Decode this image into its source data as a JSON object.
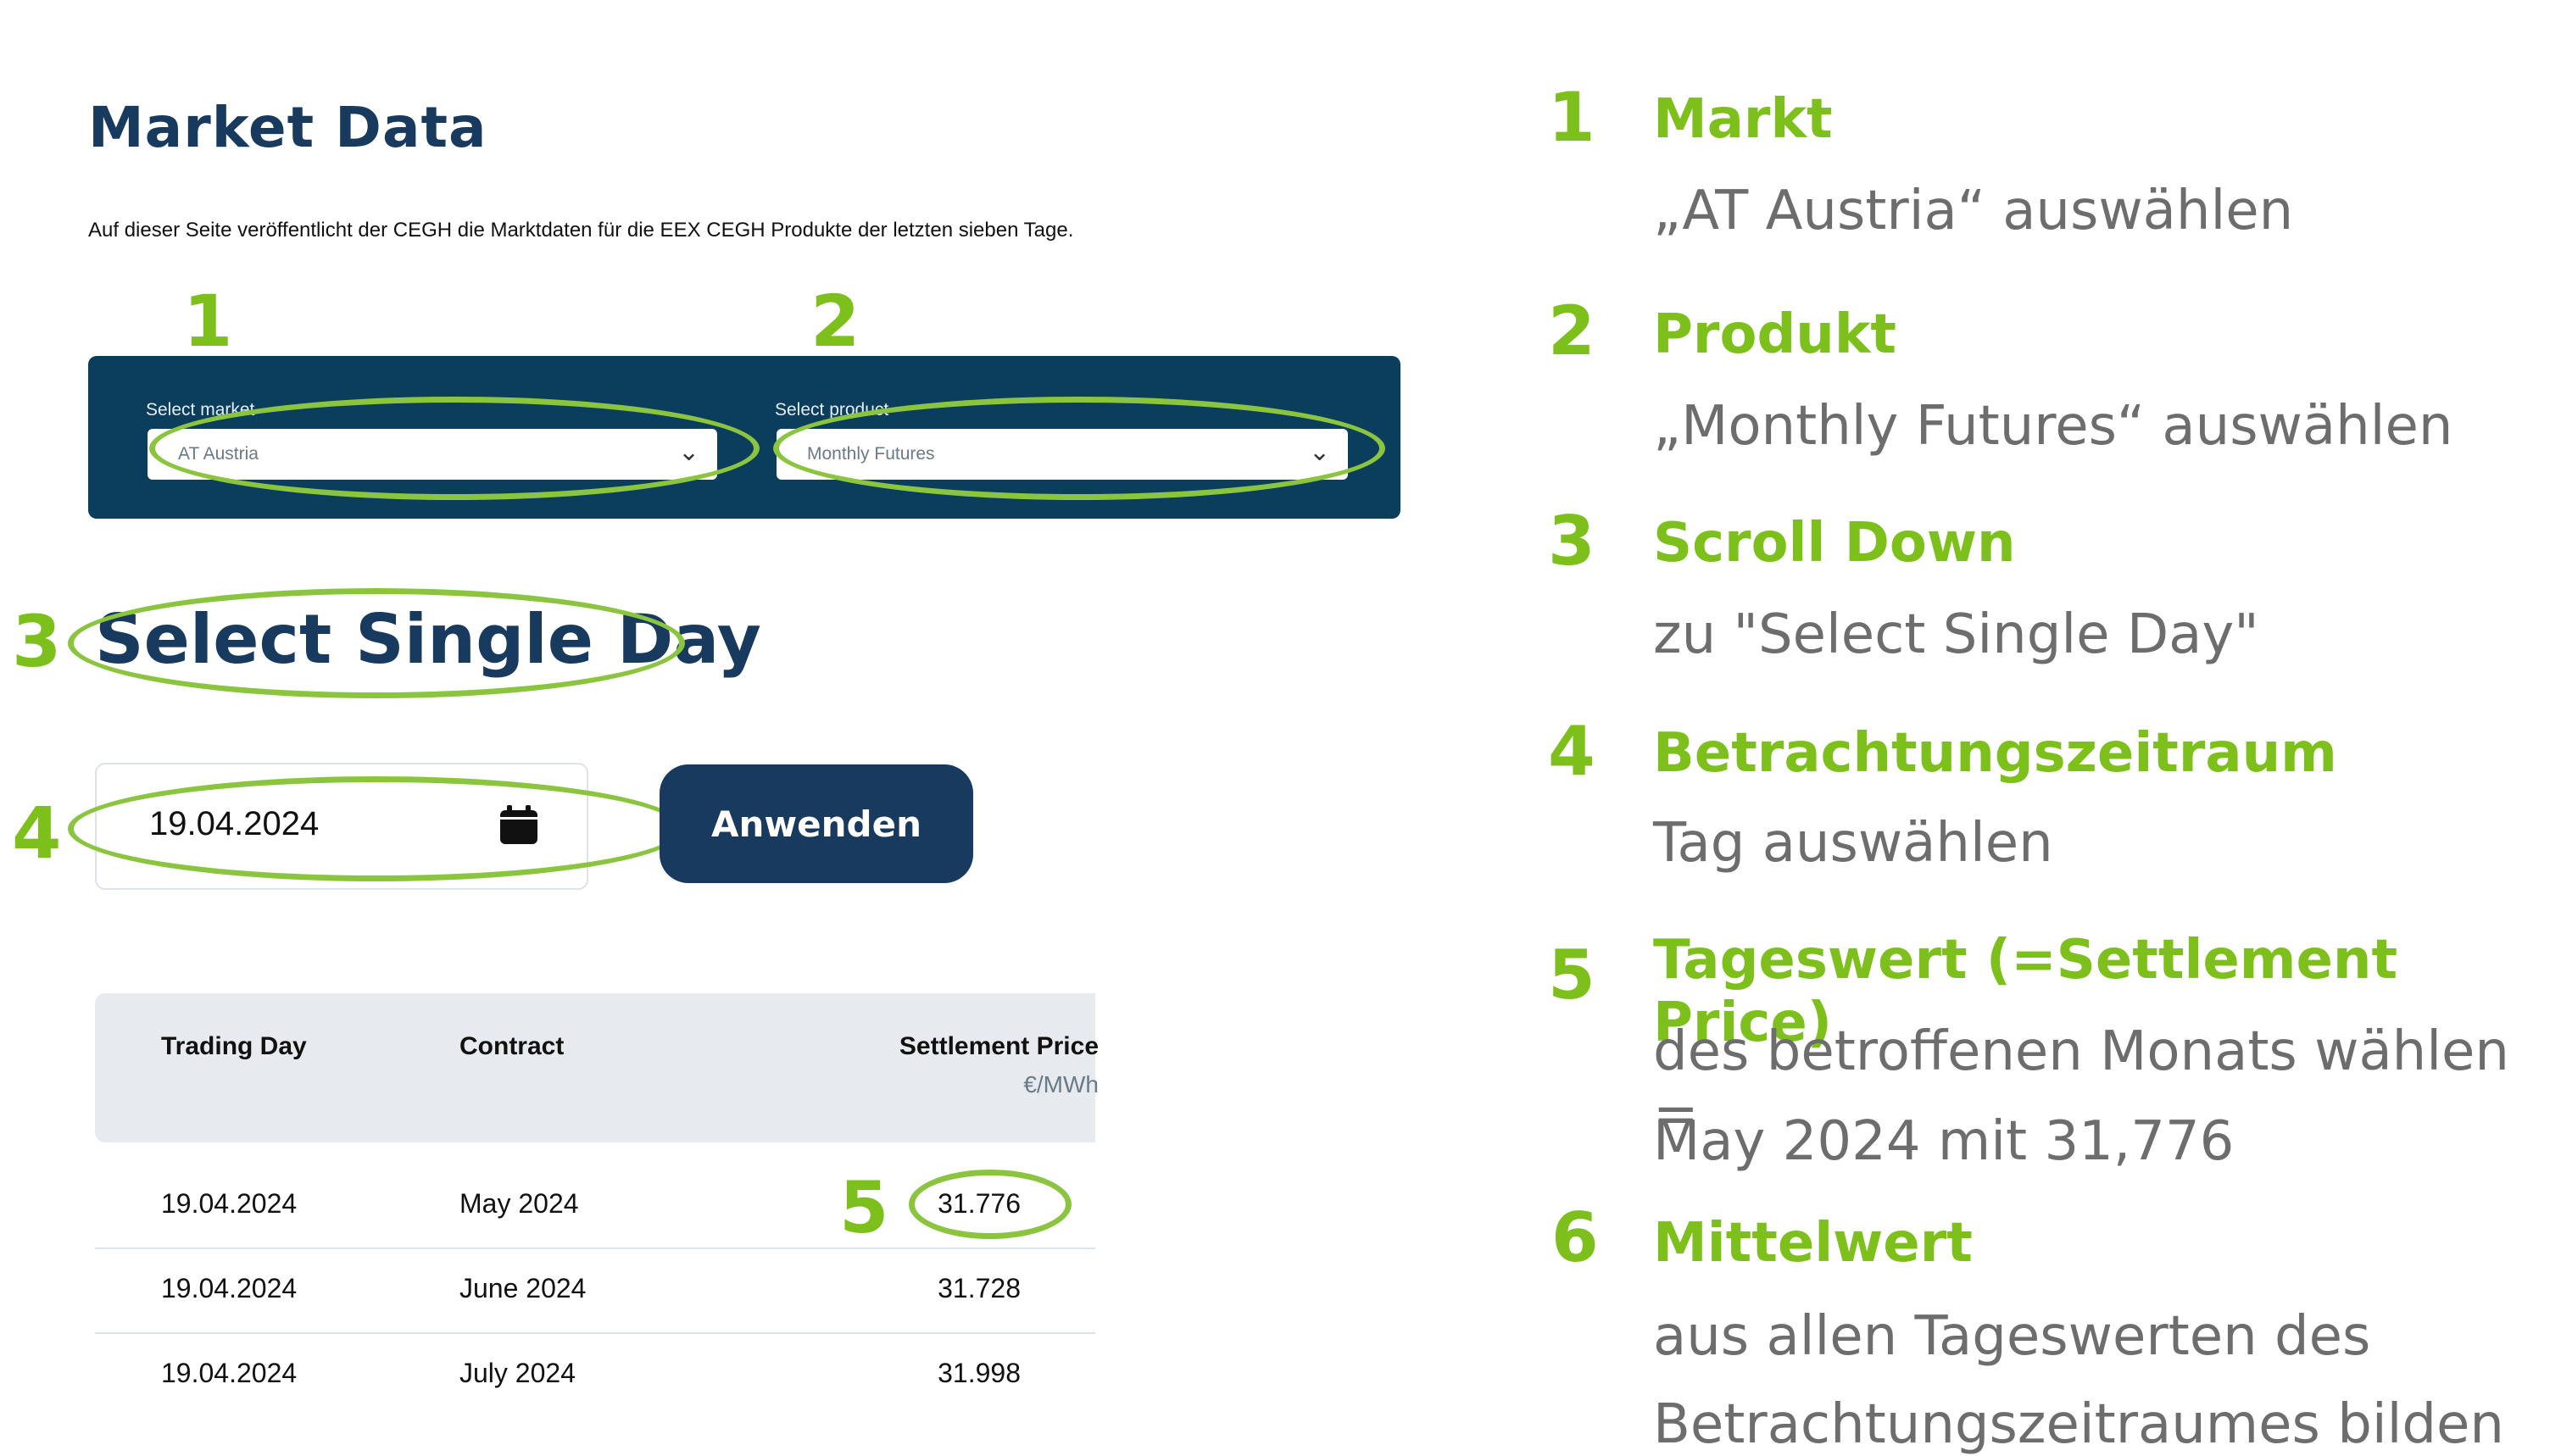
{
  "screenshot": {
    "page_title": "Market Data",
    "intro_text": "Auf dieser Seite veröffentlicht der CEGH die Marktdaten für die EEX CEGH Produkte der letzten sieben Tage.",
    "markers": {
      "m1": "1",
      "m2": "2",
      "m3": "3",
      "m4": "4",
      "m5": "5"
    },
    "filters": {
      "market_label": "Select market",
      "market_value": "AT Austria",
      "product_label": "Select product",
      "product_value": "Monthly Futures"
    },
    "section_title": "Select Single Day",
    "date_value": "19.04.2024",
    "apply_label": "Anwenden",
    "table": {
      "headers": {
        "trading_day": "Trading Day",
        "contract": "Contract",
        "settlement": "Settlement Price",
        "unit": "€/MWh"
      },
      "rows": [
        {
          "day": "19.04.2024",
          "contract": "May 2024",
          "price": "31.776"
        },
        {
          "day": "19.04.2024",
          "contract": "June 2024",
          "price": "31.728"
        },
        {
          "day": "19.04.2024",
          "contract": "July 2024",
          "price": "31.998"
        }
      ]
    }
  },
  "instructions": [
    {
      "num": "1",
      "title": "Markt",
      "lines": [
        "„AT Austria“ auswählen"
      ]
    },
    {
      "num": "2",
      "title": "Produkt",
      "lines": [
        "„Monthly Futures“ auswählen"
      ]
    },
    {
      "num": "3",
      "title": "Scroll Down",
      "lines": [
        "zu \"Select Single Day\""
      ]
    },
    {
      "num": "4",
      "title": "Betrachtungszeitraum",
      "lines": [
        "Tag auswählen"
      ]
    },
    {
      "num": "5",
      "title": "Tageswert (=Settlement Price)",
      "lines": [
        "des betroffenen Monats wählen =",
        "May 2024 mit 31,776"
      ]
    },
    {
      "num": "6",
      "title": "Mittelwert",
      "lines": [
        "aus allen Tageswerten des",
        "Betrachtungszeitraumes bilden"
      ]
    }
  ],
  "colors": {
    "accent": "#7dc01c",
    "navy": "#173a5e",
    "panel": "#0b3d5c"
  }
}
